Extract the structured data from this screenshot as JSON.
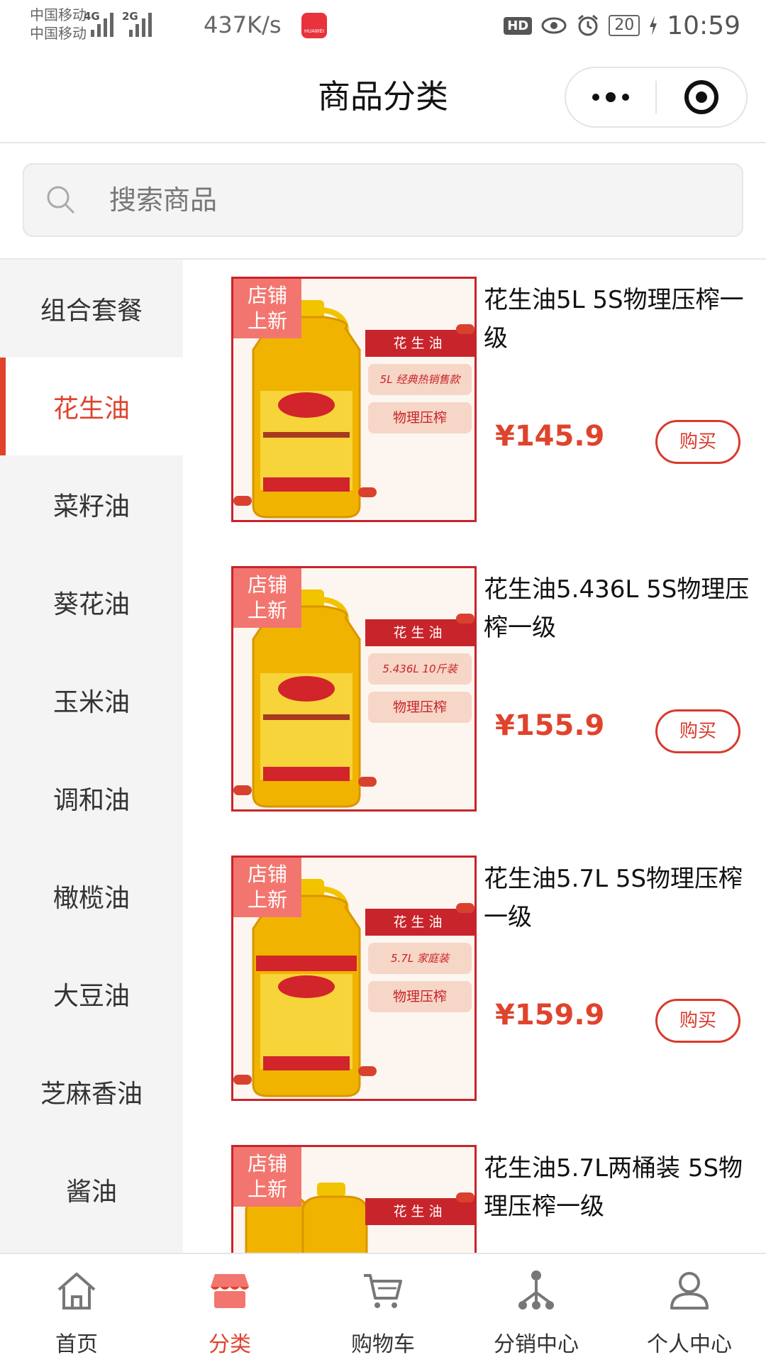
{
  "status_bar": {
    "carrier_1": "中国移动",
    "carrier_2": "中国移动",
    "net_1": "4G",
    "net_2": "2G",
    "speed": "437K/s",
    "app_badge": "HUAWEI",
    "hd": "HD",
    "battery": "20",
    "time": "10:59"
  },
  "header": {
    "title": "商品分类"
  },
  "search": {
    "placeholder": "搜索商品"
  },
  "sidebar": {
    "active_index": 1,
    "items": [
      {
        "label": "组合套餐"
      },
      {
        "label": "花生油"
      },
      {
        "label": "菜籽油"
      },
      {
        "label": "葵花油"
      },
      {
        "label": "玉米油"
      },
      {
        "label": "调和油"
      },
      {
        "label": "橄榄油"
      },
      {
        "label": "大豆油"
      },
      {
        "label": "芝麻香油"
      },
      {
        "label": "酱油"
      }
    ]
  },
  "products": [
    {
      "name": "花生油5L 5S物理压榨一级",
      "price": "¥145.9",
      "buy_label": "购买",
      "image": {
        "tag": "店铺上新",
        "tag_line1": "店铺",
        "tag_line2": "上新",
        "panel_title": "花生油",
        "pill_1": "5L 经典热销售款",
        "pill_2": "物理压榨"
      }
    },
    {
      "name": "花生油5.436L 5S物理压榨一级",
      "price": "¥155.9",
      "buy_label": "购买",
      "image": {
        "tag": "店铺上新",
        "tag_line1": "店铺",
        "tag_line2": "上新",
        "panel_title": "花生油",
        "pill_1": "5.436L 10斤装",
        "pill_2": "物理压榨"
      }
    },
    {
      "name": "花生油5.7L 5S物理压榨一级",
      "price": "¥159.9",
      "buy_label": "购买",
      "image": {
        "tag": "店铺上新",
        "tag_line1": "店铺",
        "tag_line2": "上新",
        "panel_title": "花生油",
        "pill_1": "5.7L 家庭装",
        "pill_2": "物理压榨"
      }
    },
    {
      "name": "花生油5.7L两桶装 5S物理压榨一级",
      "price": "",
      "buy_label": "",
      "image": {
        "tag": "店铺上新",
        "tag_line1": "店铺",
        "tag_line2": "上新",
        "panel_title": "花生油",
        "pill_1": "",
        "pill_2": ""
      }
    }
  ],
  "tabbar": {
    "active_index": 1,
    "items": [
      {
        "label": "首页",
        "icon": "home-icon"
      },
      {
        "label": "分类",
        "icon": "shop-icon"
      },
      {
        "label": "购物车",
        "icon": "cart-icon"
      },
      {
        "label": "分销中心",
        "icon": "distribution-icon"
      },
      {
        "label": "个人中心",
        "icon": "user-icon"
      }
    ]
  },
  "colors": {
    "accent": "#e0432c",
    "tag_bg": "#f2766f",
    "panel_red": "#c8242b",
    "sidebar_bg": "#f4f4f4"
  }
}
